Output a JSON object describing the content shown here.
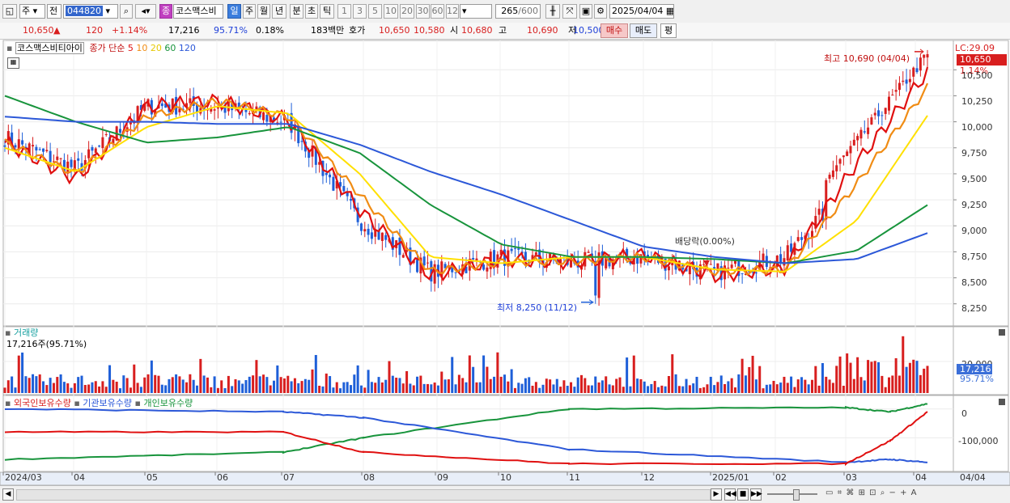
{
  "toolbar": {
    "period_select": "주",
    "compare_select": "전",
    "code": "044820",
    "stock_tag": "종",
    "stock_name": "코스맥스비",
    "period_tabs": [
      "일",
      "주",
      "월",
      "년",
      "분",
      "초",
      "틱"
    ],
    "minute_steps": [
      "1",
      "3",
      "5",
      "10",
      "20",
      "30",
      "60",
      "120"
    ],
    "count": "265",
    "count_total": "/600",
    "date": "2025/04/04"
  },
  "quote": {
    "price": "10,650",
    "arrow": "▲",
    "change": "120",
    "change_pct": "+1.14%",
    "volume": "17,216",
    "volume_ratio": "95.71%",
    "turnover": "0.18%",
    "amount": "183백만",
    "bid_label": "호가",
    "bid1": "10,650",
    "bid2": "10,580",
    "open_label": "시",
    "open": "10,680",
    "high_label": "고",
    "high": "10,690",
    "low_label": "저",
    "low": "10,500",
    "buy_label": "매수",
    "sell_label": "매도",
    "eval_label": "평"
  },
  "colors": {
    "up": "#d81e1e",
    "down": "#1e5fd8",
    "ma5": "#e01010",
    "ma10": "#f08c14",
    "ma20": "#ffe000",
    "ma60": "#18943c",
    "ma120": "#2c58d8",
    "foreign": "#e01010",
    "institution": "#2c58d8",
    "individual": "#18943c"
  },
  "price_pane": {
    "title": "코스맥스비티아이",
    "legend_prefix": "종가 단순",
    "ma_labels": [
      "5",
      "10",
      "20",
      "60",
      "120"
    ],
    "lc_label": "LC:29.09",
    "last_price_box": "10,650",
    "last_pct": "1.14%",
    "high_annot": "최고 10,690 (04/04)",
    "low_annot": "최저 8,250 (11/12)",
    "dividend_annot": "배당락(0.00%)",
    "y_ticks": [
      "10,500",
      "10,250",
      "10,000",
      "9,750",
      "9,500",
      "9,250",
      "9,000",
      "8,750",
      "8,500",
      "8,250"
    ]
  },
  "volume_pane": {
    "title": "거래량",
    "value_line": "17,216주(95.71%)",
    "last_box": "17,216",
    "last_pct": "95.71%",
    "y_tick": "20,000"
  },
  "holding_pane": {
    "titles": [
      "외국인보유수량",
      "기관보유수량",
      "개인보유수량"
    ],
    "y_ticks": [
      "0",
      "-100,000"
    ]
  },
  "x_axis": {
    "labels": [
      "2024/03",
      "04",
      "05",
      "06",
      "07",
      "08",
      "09",
      "10",
      "11",
      "12",
      "2025/01",
      "02",
      "03",
      "04"
    ],
    "last_label": "04/04"
  },
  "chart_data": {
    "type": "candlestick",
    "title": "코스맥스비티아이",
    "period": "daily",
    "x_range": [
      "2024/03",
      "2025/04/04"
    ],
    "ylim": [
      8100,
      10720
    ],
    "ma_periods": [
      5,
      10,
      20,
      60,
      120
    ],
    "high": {
      "value": 10690,
      "date": "04/04"
    },
    "low": {
      "value": 8250,
      "date": "11/12"
    },
    "last": {
      "close": 10650,
      "change": 120,
      "change_pct": 1.14,
      "open": 10680,
      "high": 10690,
      "low": 10500,
      "volume": 17216
    },
    "monthly_close_approx": [
      {
        "x": "2024/03",
        "close": 9850
      },
      {
        "x": "04",
        "close": 9550
      },
      {
        "x": "05",
        "close": 10150
      },
      {
        "x": "06",
        "close": 10150
      },
      {
        "x": "07",
        "close": 10000
      },
      {
        "x": "08",
        "close": 9050
      },
      {
        "x": "09",
        "close": 8550
      },
      {
        "x": "10",
        "close": 8700
      },
      {
        "x": "11",
        "close": 8650
      },
      {
        "x": "12",
        "close": 8700
      },
      {
        "x": "2025/01",
        "close": 8550
      },
      {
        "x": "02",
        "close": 8700
      },
      {
        "x": "03",
        "close": 9500
      },
      {
        "x": "04",
        "close": 10650
      }
    ],
    "series_ma": [
      {
        "name": "5",
        "values": [
          9800,
          9450,
          10150,
          10200,
          10020,
          9150,
          8520,
          8680,
          8650,
          8720,
          8520,
          8600,
          9600,
          10480
        ]
      },
      {
        "name": "10",
        "values": [
          9800,
          9500,
          10050,
          10200,
          10050,
          9300,
          8560,
          8650,
          8660,
          8700,
          8560,
          8580,
          9400,
          10330
        ]
      },
      {
        "name": "20",
        "values": [
          9750,
          9520,
          9950,
          10150,
          10080,
          9500,
          8700,
          8640,
          8700,
          8700,
          8580,
          8560,
          9050,
          10060
        ]
      },
      {
        "name": "60",
        "values": [
          10250,
          10000,
          9800,
          9850,
          9950,
          9700,
          9200,
          8820,
          8700,
          8700,
          8680,
          8640,
          8760,
          9200
        ]
      },
      {
        "name": "120",
        "values": [
          10050,
          10000,
          10000,
          9980,
          9980,
          9780,
          9520,
          9300,
          9050,
          8800,
          8700,
          8640,
          8680,
          8930
        ]
      }
    ],
    "holdings": {
      "foreign_x": [
        "2024/03",
        "07",
        "08",
        "11",
        "2025/03",
        "03-mid",
        "04"
      ],
      "foreign": [
        -80000,
        -80000,
        -150000,
        -190000,
        -190000,
        -110000,
        -10000
      ],
      "institution": [
        0,
        -10000,
        -30000,
        -140000,
        -185000,
        -175000,
        -185000
      ],
      "individual": [
        -175000,
        -150000,
        -100000,
        0,
        5000,
        -10000,
        18000
      ]
    }
  }
}
